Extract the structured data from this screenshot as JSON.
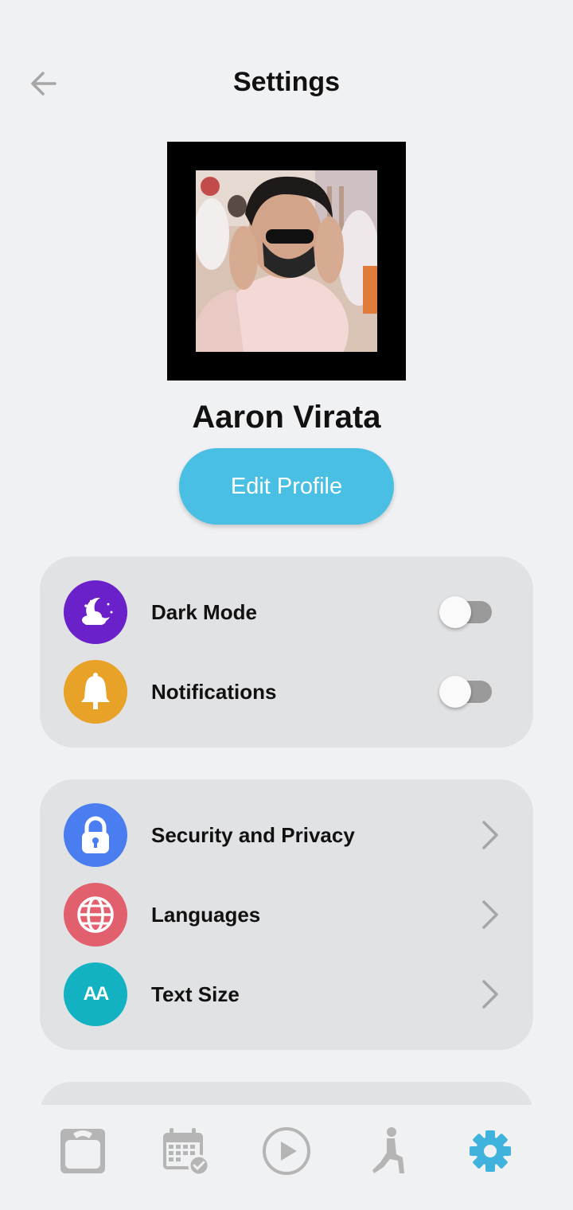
{
  "header": {
    "title": "Settings",
    "back_icon": "arrow-left-icon"
  },
  "profile": {
    "name": "Aaron Virata",
    "edit_label": "Edit Profile"
  },
  "preferences": [
    {
      "label": "Dark Mode",
      "icon": "moon-cloud-icon",
      "color": "#6b21c9",
      "enabled": false
    },
    {
      "label": "Notifications",
      "icon": "bell-icon",
      "color": "#e8a228",
      "enabled": false
    }
  ],
  "options": [
    {
      "label": "Security and Privacy",
      "icon": "lock-icon",
      "color": "#4a7ef0"
    },
    {
      "label": "Languages",
      "icon": "globe-icon",
      "color": "#e2606d"
    },
    {
      "label": "Text Size",
      "icon": "text-size-icon",
      "color": "#12b2c2",
      "icon_text": "AA"
    }
  ],
  "bottom_nav": [
    {
      "name": "scale-icon",
      "active": false
    },
    {
      "name": "calendar-icon",
      "active": false
    },
    {
      "name": "play-icon",
      "active": false
    },
    {
      "name": "exercise-icon",
      "active": false
    },
    {
      "name": "gear-icon",
      "active": true
    }
  ],
  "colors": {
    "accent": "#48bfe3",
    "background": "#f0f1f3",
    "card": "#e1e2e4",
    "nav_inactive": "#b5b5b5",
    "nav_active": "#3fb3dc"
  }
}
